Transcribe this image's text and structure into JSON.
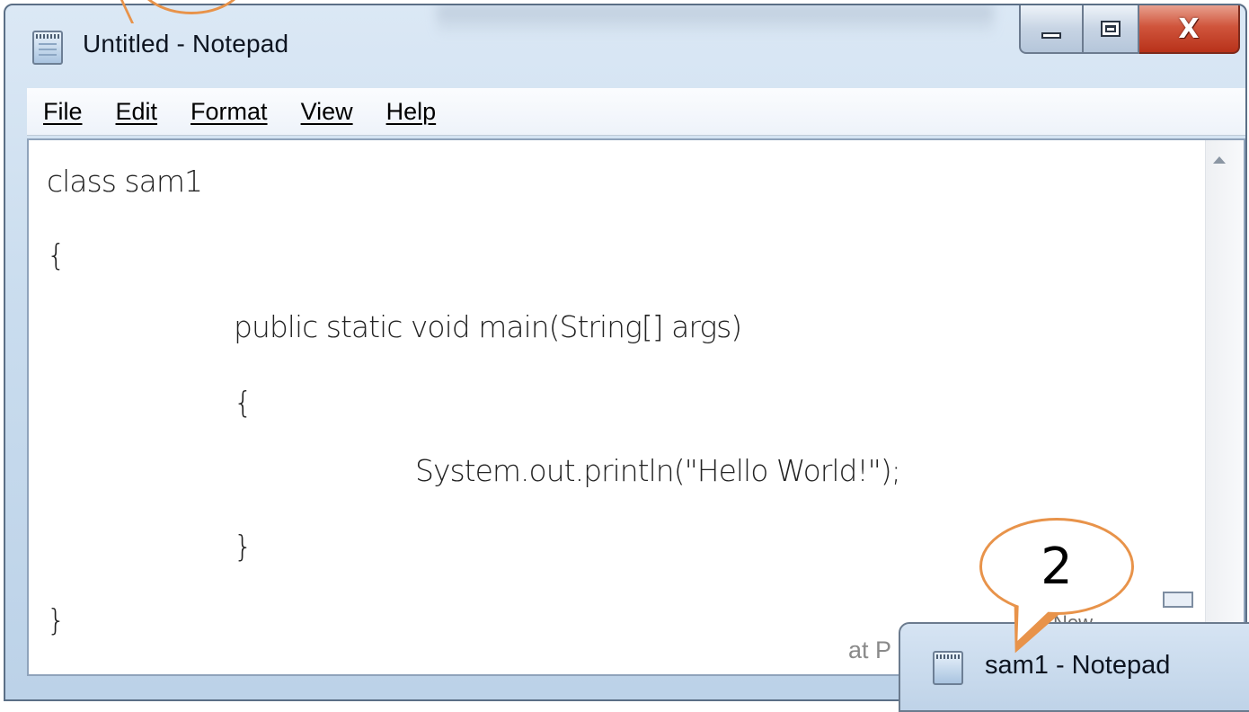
{
  "window": {
    "title": "Untitled - Notepad",
    "close_glyph": "X"
  },
  "menu": {
    "items": [
      {
        "label": "File"
      },
      {
        "label": "Edit"
      },
      {
        "label": "Format"
      },
      {
        "label": "View"
      },
      {
        "label": "Help"
      }
    ]
  },
  "editor": {
    "lines": [
      "class sam1",
      "{",
      "public static void main(String[] args)",
      "{",
      "System.out.println(\"Hello World!\");",
      "}",
      "}"
    ]
  },
  "behind": {
    "partial_text": "at P",
    "new_label": "New"
  },
  "second_window": {
    "title": "sam1 - Notepad"
  },
  "callouts": {
    "step_number": "2"
  },
  "colors": {
    "callout_outline": "#e8934a",
    "close_button": "#c8472c",
    "title_bar": "#c9dcee"
  }
}
